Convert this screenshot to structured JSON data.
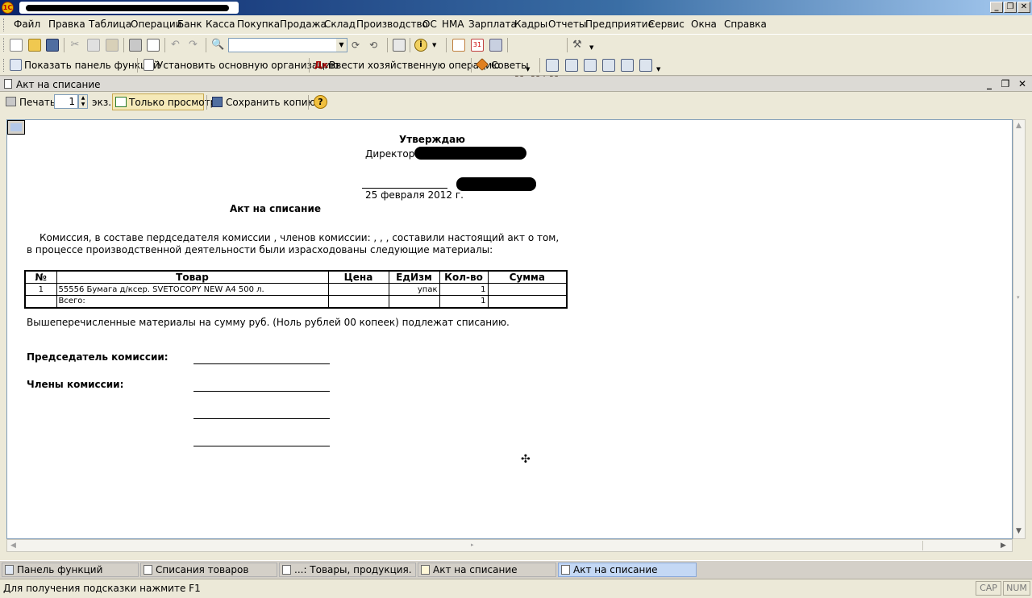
{
  "menu": [
    "Файл",
    "Правка",
    "Таблица",
    "Операции",
    "Банк",
    "Касса",
    "Покупка",
    "Продажа",
    "Склад",
    "Производство",
    "ОС",
    "НМА",
    "Зарплата",
    "Кадры",
    "Отчеты",
    "Предприятие",
    "Сервис",
    "Окна",
    "Справка"
  ],
  "toolbar2": {
    "show_panel": "Показать панель функций",
    "set_org": "Установить основную организацию",
    "enter_op": "Ввести хозяйственную операцию",
    "tips": "Советы"
  },
  "mbuttons": [
    "M",
    "M+",
    "M-"
  ],
  "doc_window": {
    "title": "Акт на списание"
  },
  "doc_toolbar": {
    "print": "Печать",
    "copies": "1",
    "copies_unit": "экз.",
    "readonly": "Только просмотр",
    "save_copy": "Сохранить копию..."
  },
  "document": {
    "approve": "Утверждаю",
    "director": "Директор",
    "date": "25 февраля 2012 г.",
    "title": "Акт на списание",
    "para1": "Комиссия, в составе пердседателя комиссии  , членов комиссии:   ,   ,   , составили настоящий акт о том,",
    "para2": "в процессе производственной деятельности были израсходованы следующие материалы:",
    "table": {
      "headers": [
        "№",
        "Товар",
        "Цена",
        "ЕдИзм",
        "Кол-во",
        "Сумма"
      ],
      "rows": [
        [
          "1",
          "55556 Бумага д/ксер. SVETOCOPY NEW A4 500 л.",
          "",
          "упак",
          "1",
          ""
        ]
      ],
      "total": [
        "",
        "Всего:",
        "",
        "",
        "1",
        ""
      ]
    },
    "summary": "Вышеперечисленные материалы на сумму  руб. (Ноль рублей 00 копеек) подлежат списанию.",
    "chairman": "Председатель комиссии:",
    "members": "Члены комиссии:"
  },
  "taskbar": [
    "Панель функций",
    "Списания товаров",
    "...: Товары, продукция. Не ...",
    "Акт на списание",
    "Акт на списание"
  ],
  "status": {
    "hint": "Для получения подсказки нажмите F1",
    "cap": "CAP",
    "num": "NUM"
  },
  "colors": {
    "titlebar": "#0a246a",
    "active_task": "#c4d8f4",
    "readonly_btn": "#f5e9b8"
  }
}
